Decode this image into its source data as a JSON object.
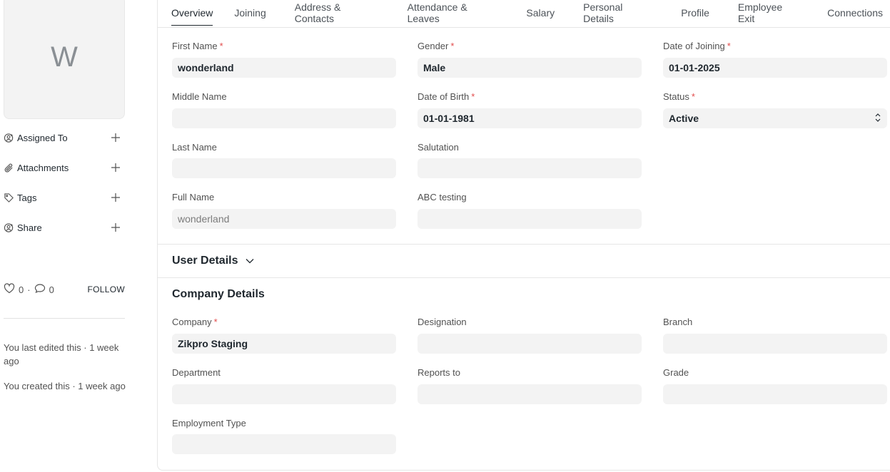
{
  "sidebar": {
    "avatar_initial": "W",
    "actions": [
      {
        "label": "Assigned To",
        "icon": "assign-icon"
      },
      {
        "label": "Attachments",
        "icon": "paperclip-icon"
      },
      {
        "label": "Tags",
        "icon": "tag-icon"
      },
      {
        "label": "Share",
        "icon": "share-icon"
      }
    ],
    "likes": "0",
    "comments": "0",
    "separator": "·",
    "follow_label": "FOLLOW",
    "activity": [
      "You last edited this · 1 week ago",
      "You created this · 1 week ago"
    ]
  },
  "tabs": [
    {
      "label": "Overview",
      "active": true
    },
    {
      "label": "Joining"
    },
    {
      "label": "Address & Contacts"
    },
    {
      "label": "Attendance & Leaves"
    },
    {
      "label": "Salary"
    },
    {
      "label": "Personal Details"
    },
    {
      "label": "Profile"
    },
    {
      "label": "Employee Exit"
    },
    {
      "label": "Connections"
    }
  ],
  "overview": {
    "first_name": {
      "label": "First Name",
      "value": "wonderland"
    },
    "gender": {
      "label": "Gender",
      "value": "Male"
    },
    "date_of_joining": {
      "label": "Date of Joining",
      "value": "01-01-2025"
    },
    "middle_name": {
      "label": "Middle Name",
      "value": ""
    },
    "date_of_birth": {
      "label": "Date of Birth",
      "value": "01-01-1981"
    },
    "status": {
      "label": "Status",
      "value": "Active"
    },
    "last_name": {
      "label": "Last Name",
      "value": ""
    },
    "salutation": {
      "label": "Salutation",
      "value": ""
    },
    "full_name": {
      "label": "Full Name",
      "value": "wonderland"
    },
    "abc_testing": {
      "label": "ABC testing",
      "value": ""
    }
  },
  "user_details": {
    "title": "User Details"
  },
  "company_details": {
    "title": "Company Details",
    "company": {
      "label": "Company",
      "value": "Zikpro Staging"
    },
    "designation": {
      "label": "Designation",
      "value": ""
    },
    "branch": {
      "label": "Branch",
      "value": ""
    },
    "department": {
      "label": "Department",
      "value": ""
    },
    "reports_to": {
      "label": "Reports to",
      "value": ""
    },
    "grade": {
      "label": "Grade",
      "value": ""
    },
    "employment_type": {
      "label": "Employment Type",
      "value": ""
    }
  },
  "required_marker": "*",
  "colors": {
    "required": "#e24c4c",
    "field_bg": "#f3f3f3",
    "text": "#1f272e"
  }
}
